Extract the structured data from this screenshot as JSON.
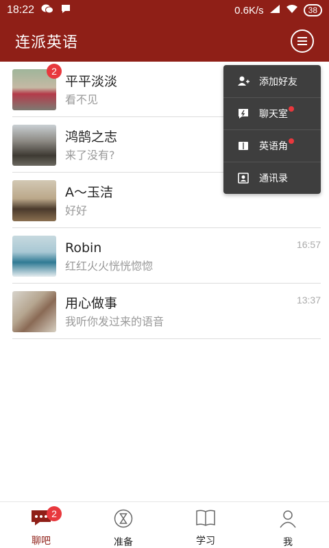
{
  "status_bar": {
    "time": "18:22",
    "speed": "0.6K/s",
    "battery": "38",
    "icons": [
      "wechat-icon",
      "chat-bubble-icon",
      "signal-icon",
      "wifi-icon"
    ]
  },
  "app_bar": {
    "title": "连派英语",
    "menu_icon": "menu-icon"
  },
  "conversations": [
    {
      "name": "平平淡淡",
      "message": "看不见",
      "time": "",
      "badge": "2"
    },
    {
      "name": "鸿鹄之志",
      "message": "来了没有?",
      "time": "",
      "badge": ""
    },
    {
      "name": "A～玉洁",
      "message": "好好",
      "time": "",
      "badge": ""
    },
    {
      "name": "Robin",
      "message": "红红火火恍恍惚惚",
      "time": "16:57",
      "badge": ""
    },
    {
      "name": "用心做事",
      "message": "我听你发过来的语音",
      "time": "13:37",
      "badge": ""
    }
  ],
  "popup_menu": {
    "items": [
      {
        "label": "添加好友",
        "icon": "add-friend-icon"
      },
      {
        "label": "聊天室",
        "icon": "chat-room-icon",
        "dot": true
      },
      {
        "label": "英语角",
        "icon": "english-corner-icon",
        "dot": true
      },
      {
        "label": "通讯录",
        "icon": "contacts-icon"
      }
    ]
  },
  "tab_bar": {
    "tabs": [
      {
        "label": "聊吧",
        "icon": "chat-bubble-icon",
        "badge": "2",
        "active": true
      },
      {
        "label": "准备",
        "icon": "hourglass-icon"
      },
      {
        "label": "学习",
        "icon": "book-icon"
      },
      {
        "label": "我",
        "icon": "person-icon"
      }
    ]
  },
  "colors": {
    "primary": "#8f1f17",
    "badge": "#e8383d",
    "popup_bg": "#3e3e3e"
  }
}
